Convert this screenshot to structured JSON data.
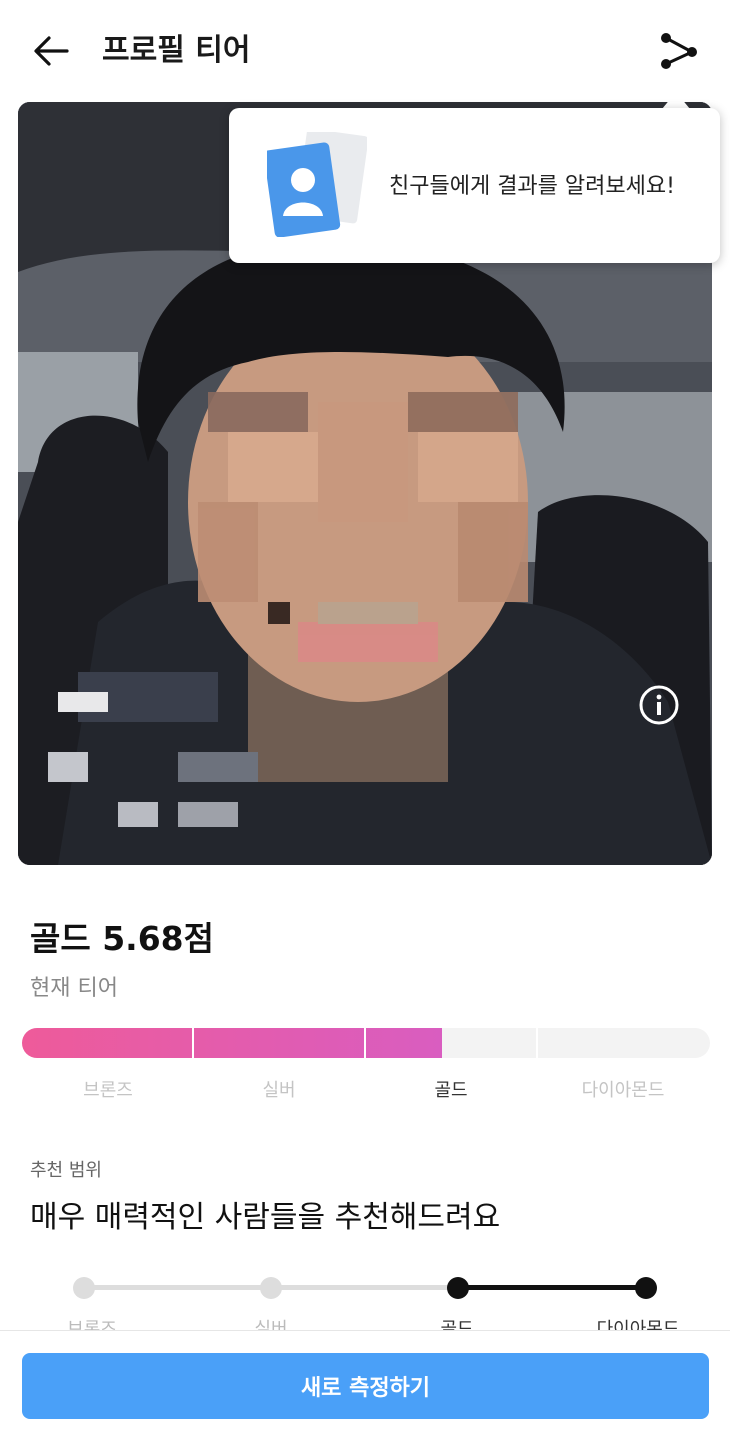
{
  "header": {
    "title": "프로필 티어",
    "back_icon": "arrow-left-icon",
    "share_icon": "share-icon"
  },
  "tooltip": {
    "text": "친구들에게 결과를 알려보세요!",
    "icon": "profile-card-icon"
  },
  "photo": {
    "info_icon": "info-icon"
  },
  "score": {
    "title": "골드 5.68점",
    "subtitle": "현재 티어",
    "progress_fraction": 0.61
  },
  "tiers": {
    "labels": [
      "브론즈",
      "실버",
      "골드",
      "다이아몬드"
    ],
    "current": "골드"
  },
  "recommend": {
    "caption": "추천 범위",
    "title": "매우 매력적인 사람들을 추천해드려요",
    "range_labels": [
      "브론즈",
      "실버",
      "골드",
      "다이아몬드"
    ],
    "range_selected": [
      "골드",
      "다이아몬드"
    ]
  },
  "cta": {
    "label": "새로 측정하기"
  },
  "colors": {
    "tier_gradient_start": "#ee5b9a",
    "tier_gradient_end": "#d95dc0",
    "cta": "#4aa0f8",
    "range_active": "#111111",
    "range_inactive": "#dddddd"
  }
}
